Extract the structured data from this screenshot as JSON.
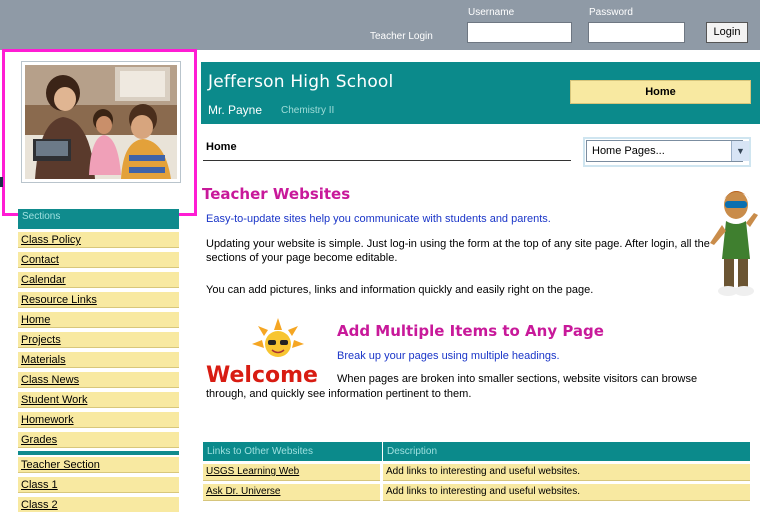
{
  "login_bar": {
    "teacher_login_label": "Teacher Login",
    "username_label": "Username",
    "password_label": "Password",
    "username_value": "",
    "password_value": "",
    "login_button": "Login"
  },
  "sidebar": {
    "header": "Sections",
    "items": [
      {
        "label": "Class Policy"
      },
      {
        "label": "Contact"
      },
      {
        "label": "Calendar"
      },
      {
        "label": "Resource Links"
      },
      {
        "label": "Home"
      },
      {
        "label": "Projects"
      },
      {
        "label": "Materials"
      },
      {
        "label": "Class News"
      },
      {
        "label": "Student Work"
      },
      {
        "label": "Homework"
      },
      {
        "label": "Grades"
      }
    ],
    "teacher_items": [
      {
        "label": "Teacher Section"
      },
      {
        "label": "Class 1"
      },
      {
        "label": "Class 2"
      }
    ]
  },
  "header": {
    "school": "Jefferson High School",
    "teacher": "Mr. Payne",
    "course": "Chemistry II",
    "home_button": "Home"
  },
  "breadcrumb": "Home",
  "page_select": {
    "value": "Home Pages..."
  },
  "section1": {
    "title": "Teacher Websites",
    "subtitle": "Easy-to-update sites help you communicate with students and parents.",
    "paragraph1": "Updating your website is simple. Just log-in using the form at the top of any site page. After login, all the sections of your page become editable.",
    "paragraph2": "You can add pictures, links and information quickly and easily right on the page."
  },
  "section2": {
    "title": "Add Multiple Items to Any Page",
    "subtitle": "Break up your pages using multiple headings.",
    "paragraph_line1": "When pages are broken into smaller sections, website visitors can browse",
    "paragraph_line2": "through, and quickly see information pertinent to them.",
    "welcome_text": "Welcome"
  },
  "links_table": {
    "headers": [
      "Links to Other Websites",
      "Description"
    ],
    "rows": [
      {
        "site": "USGS Learning Web",
        "desc": "Add links to interesting and useful websites."
      },
      {
        "site": "Ask Dr. Universe",
        "desc": "Add links to interesting and useful websites."
      }
    ]
  },
  "colors": {
    "teal": "#0b8a8b",
    "cream": "#f8e9a1",
    "magenta": "#c8199a",
    "highlight": "#ff1cd4",
    "link_blue": "#1a35c8"
  }
}
